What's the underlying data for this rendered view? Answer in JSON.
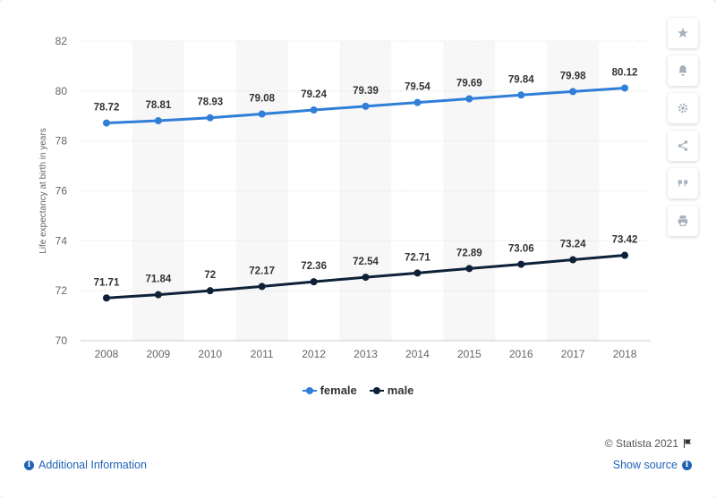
{
  "chart_data": {
    "type": "line",
    "categories": [
      "2008",
      "2009",
      "2010",
      "2011",
      "2012",
      "2013",
      "2014",
      "2015",
      "2016",
      "2017",
      "2018"
    ],
    "series": [
      {
        "name": "female",
        "color": "#2f7ed8",
        "values": [
          78.72,
          78.81,
          78.93,
          79.08,
          79.24,
          79.39,
          79.54,
          79.69,
          79.84,
          79.98,
          80.12
        ]
      },
      {
        "name": "male",
        "color": "#0d2238",
        "values": [
          71.71,
          71.84,
          72,
          72.17,
          72.36,
          72.54,
          72.71,
          72.89,
          73.06,
          73.24,
          73.42
        ]
      }
    ],
    "ylabel": "Life expectancy at birth in years",
    "xlabel": "",
    "ylim": [
      70,
      82
    ],
    "yticks": [
      "70",
      "72",
      "74",
      "76",
      "78",
      "80",
      "82"
    ],
    "grid": true,
    "legend_position": "bottom"
  },
  "credits": "© Statista 2021",
  "footer": {
    "additional_info": "Additional Information",
    "show_source": "Show source"
  },
  "tools": [
    "star-icon",
    "bell-icon",
    "gear-icon",
    "share-icon",
    "quote-icon",
    "print-icon"
  ],
  "colors": {
    "accent": "#1f63b6",
    "tool_icon": "#a7b0bd"
  }
}
